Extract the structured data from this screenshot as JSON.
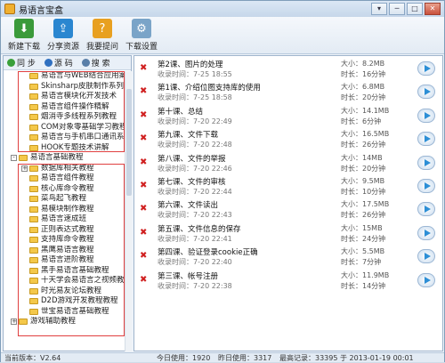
{
  "window": {
    "title": "易语言宝盒",
    "min_label": "─",
    "max_label": "□",
    "close_label": "✕",
    "opt_label": "▾"
  },
  "toolbar": [
    {
      "label": "新建下载",
      "color": "#3a9a3a",
      "icon": "download-icon"
    },
    {
      "label": "分享资源",
      "color": "#2a86d0",
      "icon": "share-icon"
    },
    {
      "label": "我要提问",
      "color": "#e8a020",
      "icon": "question-icon"
    },
    {
      "label": "下载设置",
      "color": "#7aa4c8",
      "icon": "settings-icon"
    }
  ],
  "left_header": {
    "sync": "同 步",
    "source": "源 码",
    "search": "搜 索"
  },
  "tree": [
    {
      "label": "易语言与WEB结合应用案",
      "indent": 2
    },
    {
      "label": "Skinsharp皮肤制作系列",
      "indent": 2
    },
    {
      "label": "易语言模块化开发技术",
      "indent": 2
    },
    {
      "label": "易语言组件操作精解",
      "indent": 2
    },
    {
      "label": "烟消寺多线程系列教程",
      "indent": 2
    },
    {
      "label": "COM对象零基础学习教程",
      "indent": 2
    },
    {
      "label": "易语言与手机串口通讯系",
      "indent": 2
    },
    {
      "label": "HOOK专题技术讲解",
      "indent": 2
    },
    {
      "label": "易语言基础教程",
      "indent": 1,
      "expander": "-"
    },
    {
      "label": "数据库相关教程",
      "indent": 2,
      "expander": "+"
    },
    {
      "label": "易语言组件教程",
      "indent": 2
    },
    {
      "label": "核心库命令教程",
      "indent": 2
    },
    {
      "label": "菜鸟起飞教程",
      "indent": 2
    },
    {
      "label": "易模块制作教程",
      "indent": 2
    },
    {
      "label": "易语言速成班",
      "indent": 2
    },
    {
      "label": "正则表达式教程",
      "indent": 2
    },
    {
      "label": "支持库命令教程",
      "indent": 2
    },
    {
      "label": "黑鹰易语言教程",
      "indent": 2
    },
    {
      "label": "易语言进阶教程",
      "indent": 2
    },
    {
      "label": "黑手易语言基础教程",
      "indent": 2
    },
    {
      "label": "十天学会易语言之视频教",
      "indent": 2
    },
    {
      "label": "时光易友论坛教程",
      "indent": 2
    },
    {
      "label": "D2D游戏开发教程教程",
      "indent": 2
    },
    {
      "label": "世宝易语言基础教程",
      "indent": 2
    },
    {
      "label": "游戏辅助教程",
      "indent": 1,
      "expander": "+"
    }
  ],
  "lessons": [
    {
      "title": "第2课、图片的处理",
      "date": "收录时间：7-25 18:55",
      "size": "大小：8.2MB",
      "duration": "时长：16分钟"
    },
    {
      "title": "第1课、介绍位图支持库的使用",
      "date": "收录时间：7-25 18:58",
      "size": "大小：6.8MB",
      "duration": "时长：20分钟"
    },
    {
      "title": "第十课、总结",
      "date": "收录时间：7-20 22:49",
      "size": "大小：14.1MB",
      "duration": "时长：6分钟"
    },
    {
      "title": "第九课、文件下载",
      "date": "收录时间：7-20 22:48",
      "size": "大小：16.5MB",
      "duration": "时长：26分钟"
    },
    {
      "title": "第八课、文件的举报",
      "date": "收录时间：7-20 22:46",
      "size": "大小：14MB",
      "duration": "时长：20分钟"
    },
    {
      "title": "第七课、文件的审核",
      "date": "收录时间：7-20 22:44",
      "size": "大小：9.5MB",
      "duration": "时长：10分钟"
    },
    {
      "title": "第六课、文件读出",
      "date": "收录时间：7-20 22:43",
      "size": "大小：17.5MB",
      "duration": "时长：26分钟"
    },
    {
      "title": "第五课、文件信息的保存",
      "date": "收录时间：7-20 22:41",
      "size": "大小：15MB",
      "duration": "时长：24分钟"
    },
    {
      "title": "第四课、验证登录cookie正确",
      "date": "收录时间：7-20 22:40",
      "size": "大小：5.5MB",
      "duration": "时长：7分钟"
    },
    {
      "title": "第三课、帐号注册",
      "date": "收录时间：7-20 22:38",
      "size": "大小：11.9MB",
      "duration": "时长：14分钟"
    }
  ],
  "status": {
    "version": "当前版本：V2.64",
    "today": "今日使用：1920",
    "yesterday": "昨日使用：3317",
    "record": "最高记录：33395 于 2013-01-19 00:01"
  }
}
